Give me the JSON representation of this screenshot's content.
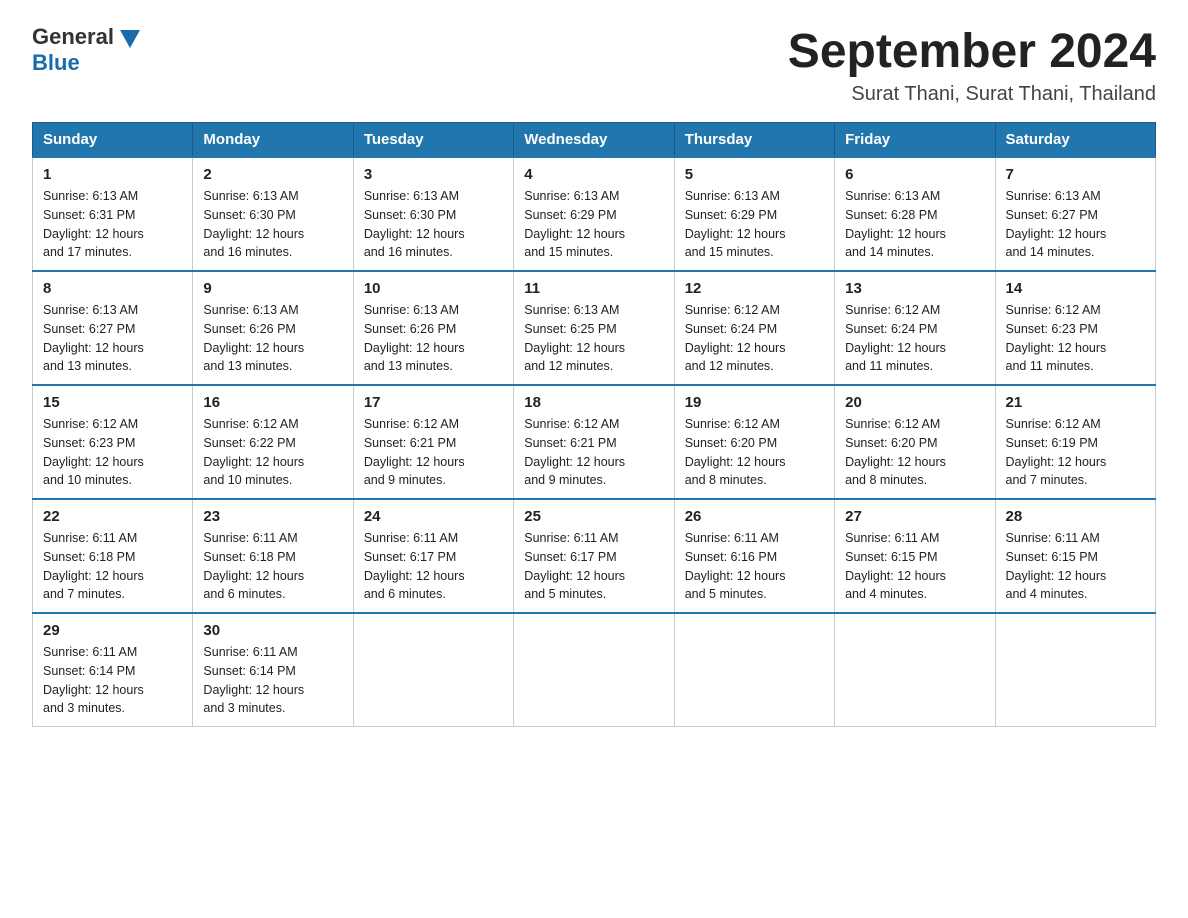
{
  "logo": {
    "general": "General",
    "blue": "Blue"
  },
  "title": "September 2024",
  "subtitle": "Surat Thani, Surat Thani, Thailand",
  "days_header": [
    "Sunday",
    "Monday",
    "Tuesday",
    "Wednesday",
    "Thursday",
    "Friday",
    "Saturday"
  ],
  "weeks": [
    [
      {
        "num": "1",
        "sunrise": "6:13 AM",
        "sunset": "6:31 PM",
        "daylight": "12 hours and 17 minutes."
      },
      {
        "num": "2",
        "sunrise": "6:13 AM",
        "sunset": "6:30 PM",
        "daylight": "12 hours and 16 minutes."
      },
      {
        "num": "3",
        "sunrise": "6:13 AM",
        "sunset": "6:30 PM",
        "daylight": "12 hours and 16 minutes."
      },
      {
        "num": "4",
        "sunrise": "6:13 AM",
        "sunset": "6:29 PM",
        "daylight": "12 hours and 15 minutes."
      },
      {
        "num": "5",
        "sunrise": "6:13 AM",
        "sunset": "6:29 PM",
        "daylight": "12 hours and 15 minutes."
      },
      {
        "num": "6",
        "sunrise": "6:13 AM",
        "sunset": "6:28 PM",
        "daylight": "12 hours and 14 minutes."
      },
      {
        "num": "7",
        "sunrise": "6:13 AM",
        "sunset": "6:27 PM",
        "daylight": "12 hours and 14 minutes."
      }
    ],
    [
      {
        "num": "8",
        "sunrise": "6:13 AM",
        "sunset": "6:27 PM",
        "daylight": "12 hours and 13 minutes."
      },
      {
        "num": "9",
        "sunrise": "6:13 AM",
        "sunset": "6:26 PM",
        "daylight": "12 hours and 13 minutes."
      },
      {
        "num": "10",
        "sunrise": "6:13 AM",
        "sunset": "6:26 PM",
        "daylight": "12 hours and 13 minutes."
      },
      {
        "num": "11",
        "sunrise": "6:13 AM",
        "sunset": "6:25 PM",
        "daylight": "12 hours and 12 minutes."
      },
      {
        "num": "12",
        "sunrise": "6:12 AM",
        "sunset": "6:24 PM",
        "daylight": "12 hours and 12 minutes."
      },
      {
        "num": "13",
        "sunrise": "6:12 AM",
        "sunset": "6:24 PM",
        "daylight": "12 hours and 11 minutes."
      },
      {
        "num": "14",
        "sunrise": "6:12 AM",
        "sunset": "6:23 PM",
        "daylight": "12 hours and 11 minutes."
      }
    ],
    [
      {
        "num": "15",
        "sunrise": "6:12 AM",
        "sunset": "6:23 PM",
        "daylight": "12 hours and 10 minutes."
      },
      {
        "num": "16",
        "sunrise": "6:12 AM",
        "sunset": "6:22 PM",
        "daylight": "12 hours and 10 minutes."
      },
      {
        "num": "17",
        "sunrise": "6:12 AM",
        "sunset": "6:21 PM",
        "daylight": "12 hours and 9 minutes."
      },
      {
        "num": "18",
        "sunrise": "6:12 AM",
        "sunset": "6:21 PM",
        "daylight": "12 hours and 9 minutes."
      },
      {
        "num": "19",
        "sunrise": "6:12 AM",
        "sunset": "6:20 PM",
        "daylight": "12 hours and 8 minutes."
      },
      {
        "num": "20",
        "sunrise": "6:12 AM",
        "sunset": "6:20 PM",
        "daylight": "12 hours and 8 minutes."
      },
      {
        "num": "21",
        "sunrise": "6:12 AM",
        "sunset": "6:19 PM",
        "daylight": "12 hours and 7 minutes."
      }
    ],
    [
      {
        "num": "22",
        "sunrise": "6:11 AM",
        "sunset": "6:18 PM",
        "daylight": "12 hours and 7 minutes."
      },
      {
        "num": "23",
        "sunrise": "6:11 AM",
        "sunset": "6:18 PM",
        "daylight": "12 hours and 6 minutes."
      },
      {
        "num": "24",
        "sunrise": "6:11 AM",
        "sunset": "6:17 PM",
        "daylight": "12 hours and 6 minutes."
      },
      {
        "num": "25",
        "sunrise": "6:11 AM",
        "sunset": "6:17 PM",
        "daylight": "12 hours and 5 minutes."
      },
      {
        "num": "26",
        "sunrise": "6:11 AM",
        "sunset": "6:16 PM",
        "daylight": "12 hours and 5 minutes."
      },
      {
        "num": "27",
        "sunrise": "6:11 AM",
        "sunset": "6:15 PM",
        "daylight": "12 hours and 4 minutes."
      },
      {
        "num": "28",
        "sunrise": "6:11 AM",
        "sunset": "6:15 PM",
        "daylight": "12 hours and 4 minutes."
      }
    ],
    [
      {
        "num": "29",
        "sunrise": "6:11 AM",
        "sunset": "6:14 PM",
        "daylight": "12 hours and 3 minutes."
      },
      {
        "num": "30",
        "sunrise": "6:11 AM",
        "sunset": "6:14 PM",
        "daylight": "12 hours and 3 minutes."
      },
      null,
      null,
      null,
      null,
      null
    ]
  ],
  "labels": {
    "sunrise": "Sunrise:",
    "sunset": "Sunset:",
    "daylight": "Daylight:"
  }
}
